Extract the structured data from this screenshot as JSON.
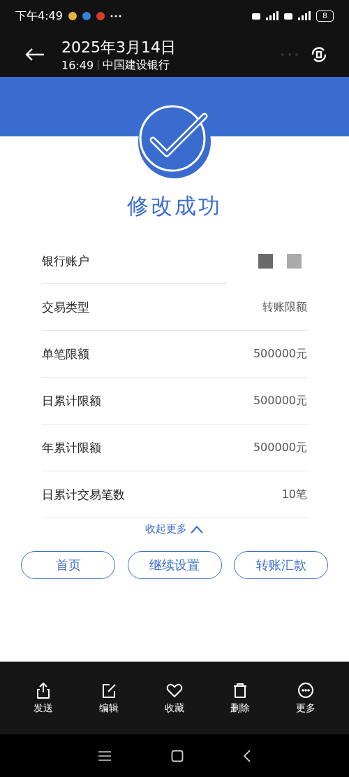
{
  "status_bar": {
    "time": "下午4:49",
    "battery": "8"
  },
  "overlay": {
    "date": "2025年3月14日",
    "time": "16:49",
    "source": "中国建设银行"
  },
  "result": {
    "title": "修改成功"
  },
  "details": [
    {
      "label": "银行账户",
      "kind": "masked"
    },
    {
      "label": "交易类型",
      "value": "转账限额",
      "kind": "text"
    },
    {
      "label": "单笔限额",
      "value": "500000元",
      "kind": "text"
    },
    {
      "label": "日累计限额",
      "value": "500000元",
      "kind": "text"
    },
    {
      "label": "年累计限额",
      "value": "500000元",
      "kind": "text"
    },
    {
      "label": "日累计交易笔数",
      "value": "10笔",
      "kind": "text"
    }
  ],
  "collapse_link": "收起更多",
  "buttons": [
    "首页",
    "继续设置",
    "转账汇款"
  ],
  "toolbar": [
    {
      "label": "发送",
      "kind": "share"
    },
    {
      "label": "编辑",
      "kind": "edit"
    },
    {
      "label": "收藏",
      "kind": "heart"
    },
    {
      "label": "删除",
      "kind": "trash"
    },
    {
      "label": "更多",
      "kind": "more"
    }
  ]
}
